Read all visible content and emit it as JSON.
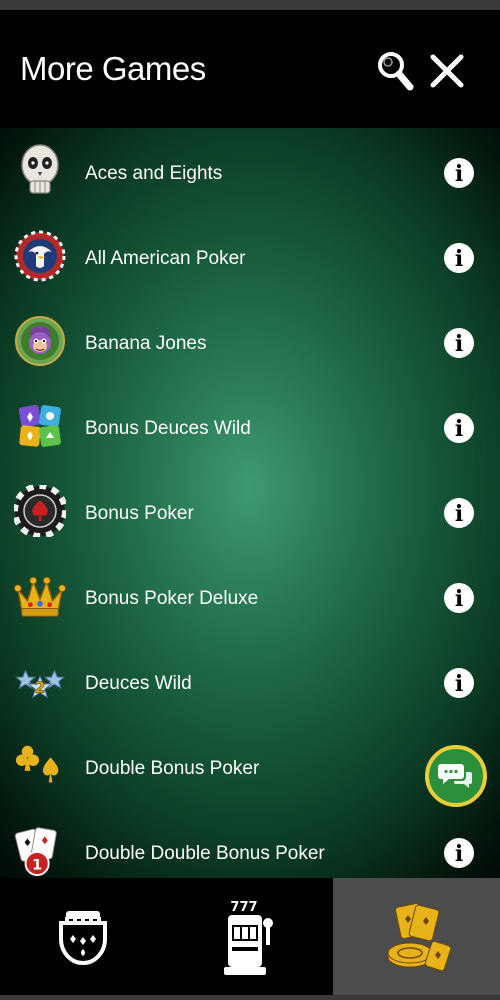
{
  "header": {
    "title": "More Games",
    "search_icon": "search-icon",
    "close_icon": "close-icon"
  },
  "games": [
    {
      "name": "Aces and Eights",
      "icon": "skull-icon"
    },
    {
      "name": "All American Poker",
      "icon": "eagle-icon"
    },
    {
      "name": "Banana Jones",
      "icon": "monkey-icon"
    },
    {
      "name": "Bonus Deuces Wild",
      "icon": "colorful-cards-icon"
    },
    {
      "name": "Bonus Poker",
      "icon": "poker-chip-spade-icon"
    },
    {
      "name": "Bonus Poker Deluxe",
      "icon": "crown-icon"
    },
    {
      "name": "Deuces Wild",
      "icon": "stars-two-icon"
    },
    {
      "name": "Double Bonus Poker",
      "icon": "club-spade-icon"
    },
    {
      "name": "Double Double Bonus Poker",
      "icon": "cards-badge-one-icon"
    }
  ],
  "info_icon": "info-icon",
  "chat_fab": {
    "icon": "chat-bubbles-icon"
  },
  "bottom_nav": [
    {
      "name": "video-poker-table",
      "icon": "card-table-icon",
      "active": false
    },
    {
      "name": "slots",
      "icon": "slot-machine-icon",
      "active": false
    },
    {
      "name": "more-games",
      "icon": "cards-chips-icon",
      "active": true
    }
  ],
  "colors": {
    "header_bg": "#000000",
    "felt_center": "#3e9a72",
    "felt_edge": "#010a05",
    "active_tab_bg": "#4c4c4c",
    "chat_fab_bg": "#2c8f3c",
    "chat_fab_ring": "#e8cf3a",
    "gold": "#e8b21a"
  }
}
